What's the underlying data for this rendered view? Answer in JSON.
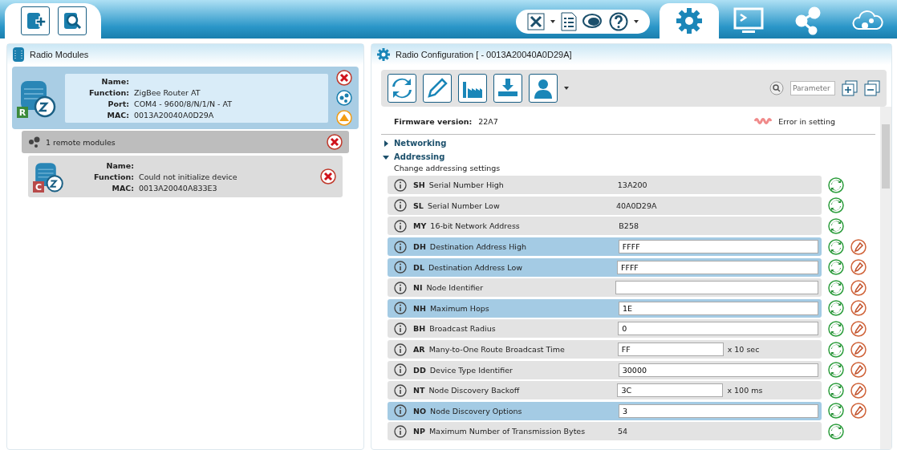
{
  "left_panel": {
    "title": "Radio Modules",
    "local_module": {
      "selected": true,
      "badge": "R",
      "fields": [
        {
          "label": "Name:"
        },
        {
          "label": "Function:",
          "value": "ZigBee Router AT"
        },
        {
          "label": "Port:",
          "value": "COM4 - 9600/8/N/1/N - AT"
        },
        {
          "label": "MAC:",
          "value": "0013A20040A0D29A"
        }
      ]
    },
    "remote_header": "1 remote modules",
    "remote_modules": [
      {
        "badge": "C",
        "fields": [
          {
            "label": "Name:"
          },
          {
            "label": "Function:",
            "value": "Could not initialize device"
          },
          {
            "label": "MAC:",
            "value": "0013A20040A833E3"
          }
        ]
      }
    ]
  },
  "tabs": [
    {
      "kind": "configuration",
      "selected": true
    },
    {
      "kind": "console",
      "selected": false
    },
    {
      "kind": "network",
      "selected": false
    },
    {
      "kind": "cloud",
      "selected": false
    }
  ],
  "right_panel": {
    "title": "Radio Configuration [  - 0013A20040A0D29A]",
    "search": {
      "placeholder": "Parameter"
    },
    "firmware": {
      "label": "Firmware version:",
      "value": "22A7"
    },
    "legend": "Error in setting",
    "sections": [
      {
        "title": "Networking",
        "expanded": false
      },
      {
        "title": "Addressing",
        "expanded": true,
        "description": "Change addressing settings"
      }
    ],
    "rows": [
      {
        "code": "SH",
        "name": "Serial Number High",
        "value": "13A200",
        "kind": "readonly",
        "changed": false
      },
      {
        "code": "SL",
        "name": "Serial Number Low",
        "value": "40A0D29A",
        "kind": "readonly",
        "changed": false
      },
      {
        "code": "MY",
        "name": "16-bit Network Address",
        "value": "B258",
        "kind": "readonly",
        "changed": false
      },
      {
        "code": "DH",
        "name": "Destination Address High",
        "value": "FFFF",
        "kind": "edit",
        "changed": true
      },
      {
        "code": "DL",
        "name": "Destination Address Low",
        "value": "FFFF",
        "kind": "edit",
        "changed": true
      },
      {
        "code": "NI",
        "name": "Node Identifier",
        "value": "",
        "kind": "edit",
        "changed": false
      },
      {
        "code": "NH",
        "name": "Maximum Hops",
        "value": "1E",
        "kind": "edit",
        "changed": true
      },
      {
        "code": "BH",
        "name": "Broadcast Radius",
        "value": "0",
        "kind": "edit",
        "changed": false
      },
      {
        "code": "AR",
        "name": "Many-to-One Route Broadcast Time",
        "value": "FF",
        "unit": "x 10 sec",
        "kind": "edit",
        "changed": false
      },
      {
        "code": "DD",
        "name": "Device Type Identifier",
        "value": "30000",
        "kind": "edit",
        "changed": false
      },
      {
        "code": "NT",
        "name": "Node Discovery Backoff",
        "value": "3C",
        "unit": "x 100 ms",
        "kind": "edit",
        "changed": false
      },
      {
        "code": "NO",
        "name": "Node Discovery Options",
        "value": "3",
        "kind": "edit",
        "changed": true
      },
      {
        "code": "NP",
        "name": "Maximum Number of Transmission Bytes",
        "value": "54",
        "kind": "readonly",
        "changed": false
      }
    ]
  }
}
